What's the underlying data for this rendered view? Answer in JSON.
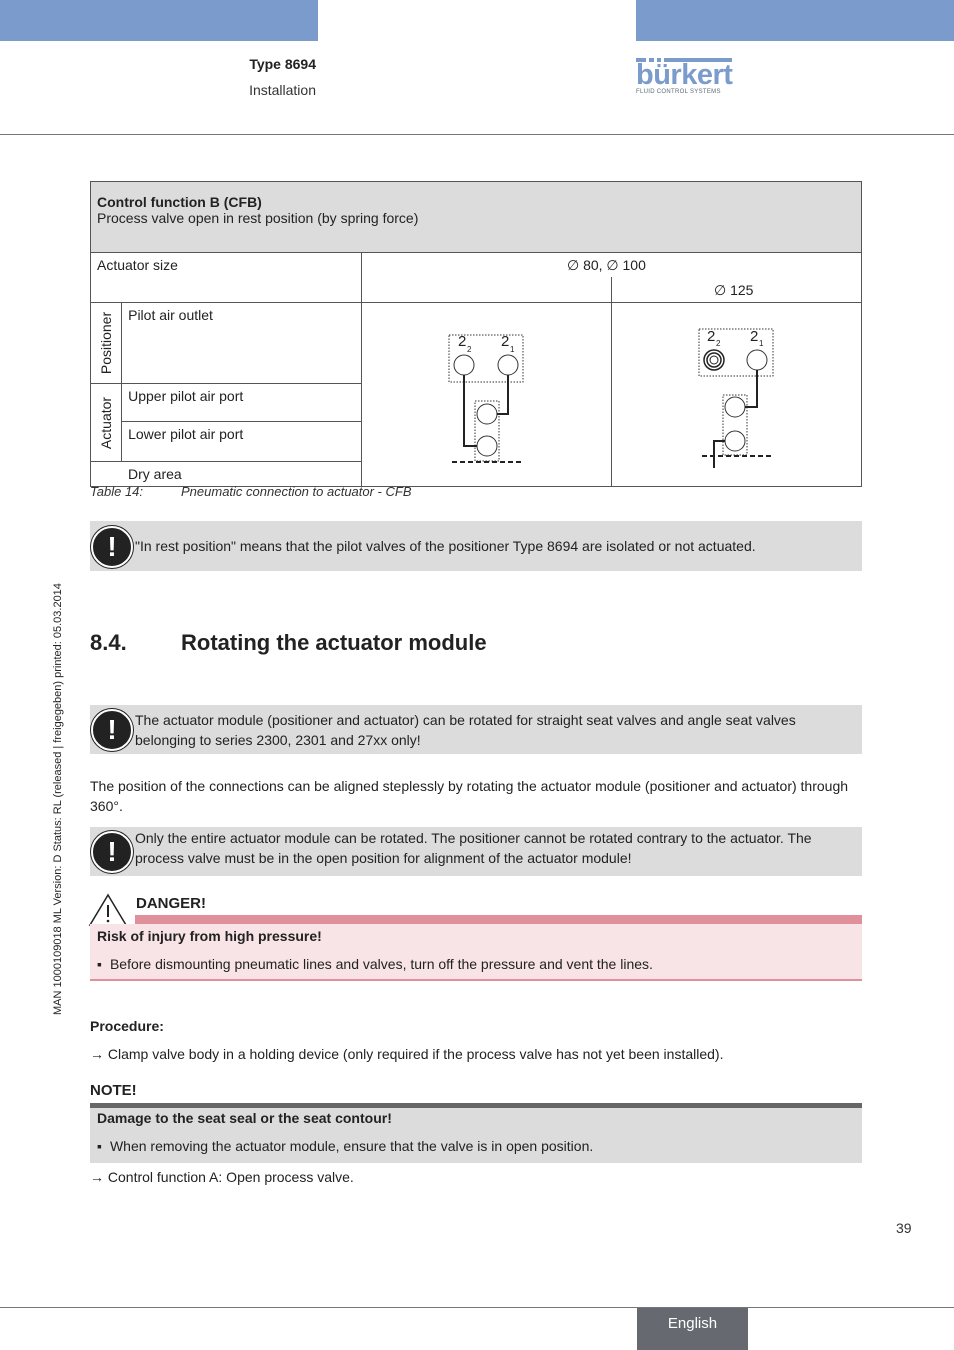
{
  "header": {
    "doc_type": "Type 8694",
    "section": "Installation",
    "logo_word": "bürkert",
    "logo_tagline": "FLUID CONTROL SYSTEMS",
    "brand_color": "#7a9bcb"
  },
  "side_text": "MAN  1000109018  ML  Version: D  Status: RL (released | freigegeben)  printed: 05.03.2014",
  "table": {
    "title": "Control function B (CFB)",
    "subtitle": "Process valve open in rest position (by spring force)",
    "actuator_size_label": "Actuator size",
    "size_col1": "∅ 80, ∅ 100",
    "size_col2": "∅ 125",
    "group_positioner": "Positioner",
    "group_actuator": "Actuator",
    "row_pilot_outlet": "Pilot air outlet",
    "row_upper_port": "Upper pilot air port",
    "row_lower_port": "Lower pilot air port",
    "row_dry_area": "Dry area",
    "diagram_label_2": "2",
    "diagram_sub_2": "2",
    "diagram_sub_1": "1",
    "caption_number": "Table 14:",
    "caption_text": "Pneumatic connection to actuator - CFB"
  },
  "notes": {
    "rest_position": "\"In rest position\" means that the pilot valves of the positioner Type 8694 are isolated or not actuated.",
    "rotate_series": "The actuator module (positioner and actuator) can be rotated for straight seat valves and angle seat valves belonging to series 2300, 2301 and 27xx only!",
    "entire_module": "Only the entire actuator module can be rotated. The positioner cannot be rotated contrary to the actuator. The process valve must be in the open position for alignment of the actuator module!",
    "icon_glyph": "!"
  },
  "section": {
    "number": "8.4.",
    "title": "Rotating the actuator module",
    "intro": "The position of the connections can be aligned steplessly by rotating the actuator module (positioner and actuator) through 360°."
  },
  "danger": {
    "label": "DANGER!",
    "heading": "Risk of injury from high pressure!",
    "bullet": "Before dismounting pneumatic lines and valves, turn off the pressure and vent the lines.",
    "color": "#e0909a"
  },
  "procedure": {
    "label": "Procedure:",
    "step1": "→ Clamp valve body in a holding device (only required if the process valve has not yet been installed).",
    "step2": "→ Control function A: Open process valve."
  },
  "note": {
    "label": "NOTE!",
    "heading": "Damage to the seat seal or the seat contour!",
    "bullet": "When removing the actuator module, ensure that the valve is in open position."
  },
  "footer": {
    "page_number": "39",
    "language": "English"
  }
}
